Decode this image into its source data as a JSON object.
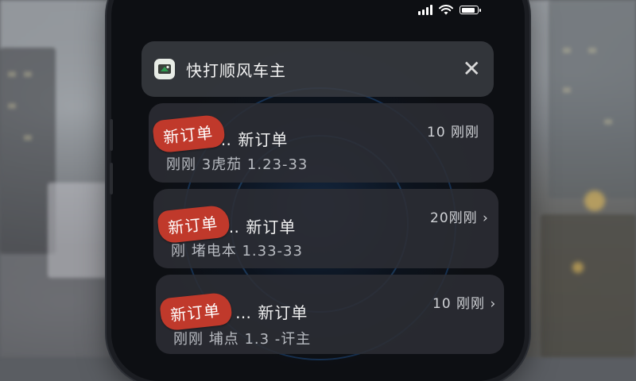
{
  "app": {
    "name": "快打顺风车主",
    "close_symbol": "✕"
  },
  "notifications": [
    {
      "stamp": "新订单",
      "title": "… 新订单",
      "detail": "刚刚 3虎茄 1.23-33",
      "time": "10 刚刚"
    },
    {
      "stamp": "新订单",
      "title": "… 新订单",
      "detail": "刚  堵电本 1.33-33",
      "time": "20刚刚 ›"
    },
    {
      "stamp": "新订单",
      "title": "… 新订单",
      "detail": "刚刚  埔点 1.3 -讦主",
      "time": "10 刚刚 ›"
    }
  ],
  "colors": {
    "stamp_red": "#c0392b",
    "card_bg": "#2c2e34",
    "app_icon_green": "#2e9b4f"
  },
  "icons": [
    "signal-icon",
    "wifi-icon",
    "battery-icon",
    "app-icon",
    "close-icon"
  ]
}
